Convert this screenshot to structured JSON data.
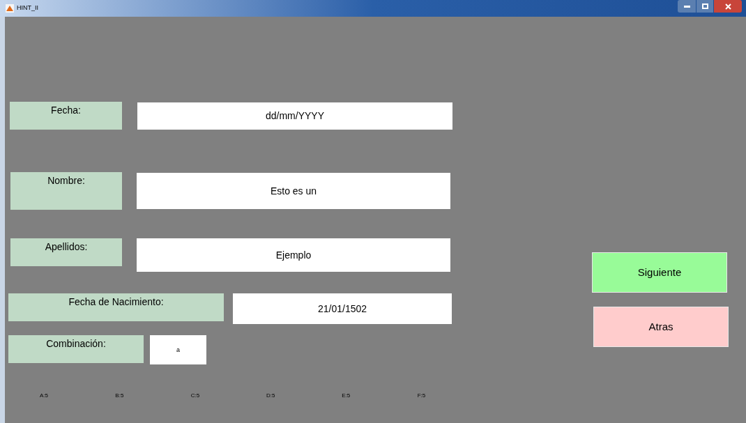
{
  "window": {
    "title": "HINT_II"
  },
  "fields": [
    {
      "label": "Fecha:",
      "value": "dd/mm/YYYY"
    },
    {
      "label": "Nombre:",
      "value": "Esto es un"
    },
    {
      "label": "Apellidos:",
      "value": "Ejemplo"
    },
    {
      "label": "Fecha de Nacimiento:",
      "value": "21/01/1502"
    },
    {
      "label": "Combinación:",
      "value": "a"
    }
  ],
  "scores": [
    "A:5",
    "B:5",
    "C:5",
    "D:5",
    "E:5",
    "F:5"
  ],
  "buttons": [
    {
      "label": "Siguiente",
      "color": "#98fb98"
    },
    {
      "label": "Atras",
      "color": "#ffcccc"
    }
  ]
}
